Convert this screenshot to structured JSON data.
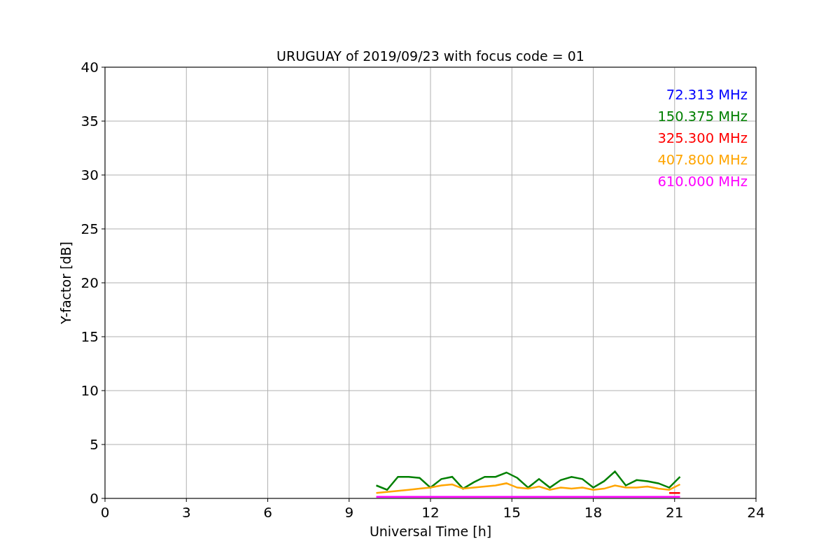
{
  "chart_data": {
    "type": "line",
    "title": "URUGUAY of 2019/09/23 with focus code = 01",
    "xlabel": "Universal Time [h]",
    "ylabel": "Y-factor [dB]",
    "x": [
      10.0,
      10.4,
      10.8,
      11.2,
      11.6,
      12.0,
      12.4,
      12.8,
      13.2,
      13.6,
      14.0,
      14.4,
      14.8,
      15.2,
      15.6,
      16.0,
      16.4,
      16.8,
      17.2,
      17.6,
      18.0,
      18.4,
      18.8,
      19.2,
      19.6,
      20.0,
      20.4,
      20.8,
      21.2
    ],
    "xlim": [
      0,
      24
    ],
    "ylim": [
      0,
      40
    ],
    "grid": true,
    "xticks": [
      0,
      3,
      6,
      9,
      12,
      15,
      18,
      21,
      24
    ],
    "yticks": [
      0,
      5,
      10,
      15,
      20,
      25,
      30,
      35,
      40
    ],
    "series": [
      {
        "name": "72.313 MHz",
        "color": "#0000ff",
        "values": [
          null,
          null,
          null,
          null,
          null,
          null,
          null,
          null,
          null,
          null,
          null,
          null,
          null,
          null,
          null,
          null,
          null,
          null,
          null,
          null,
          null,
          null,
          null,
          null,
          null,
          null,
          null,
          null,
          null
        ]
      },
      {
        "name": "150.375 MHz",
        "color": "#008000",
        "values": [
          1.2,
          0.8,
          2.0,
          2.0,
          1.9,
          1.0,
          1.8,
          2.0,
          0.9,
          1.5,
          2.0,
          2.0,
          2.4,
          1.9,
          1.0,
          1.8,
          1.0,
          1.7,
          2.0,
          1.8,
          1.0,
          1.6,
          2.5,
          1.2,
          1.7,
          1.6,
          1.4,
          1.0,
          2.0
        ]
      },
      {
        "name": "325.300 MHz",
        "color": "#ff0000",
        "values": [
          null,
          null,
          null,
          null,
          null,
          null,
          null,
          null,
          null,
          null,
          null,
          null,
          null,
          null,
          null,
          null,
          null,
          null,
          null,
          null,
          null,
          null,
          null,
          null,
          null,
          null,
          null,
          0.5,
          0.5
        ]
      },
      {
        "name": "407.800 MHz",
        "color": "#ffa500",
        "values": [
          0.5,
          0.6,
          0.7,
          0.8,
          0.9,
          1.0,
          1.2,
          1.3,
          0.9,
          1.0,
          1.1,
          1.2,
          1.4,
          1.0,
          0.9,
          1.1,
          0.8,
          1.0,
          0.9,
          1.0,
          0.8,
          0.9,
          1.2,
          1.0,
          1.0,
          1.1,
          0.9,
          0.8,
          1.3
        ]
      },
      {
        "name": "610.000 MHz",
        "color": "#ff00ff",
        "values": [
          0.15,
          0.15,
          0.15,
          0.15,
          0.15,
          0.15,
          0.15,
          0.15,
          0.15,
          0.15,
          0.15,
          0.15,
          0.15,
          0.15,
          0.15,
          0.15,
          0.15,
          0.15,
          0.15,
          0.15,
          0.15,
          0.15,
          0.15,
          0.15,
          0.15,
          0.15,
          0.15,
          0.15,
          0.15
        ]
      }
    ]
  }
}
